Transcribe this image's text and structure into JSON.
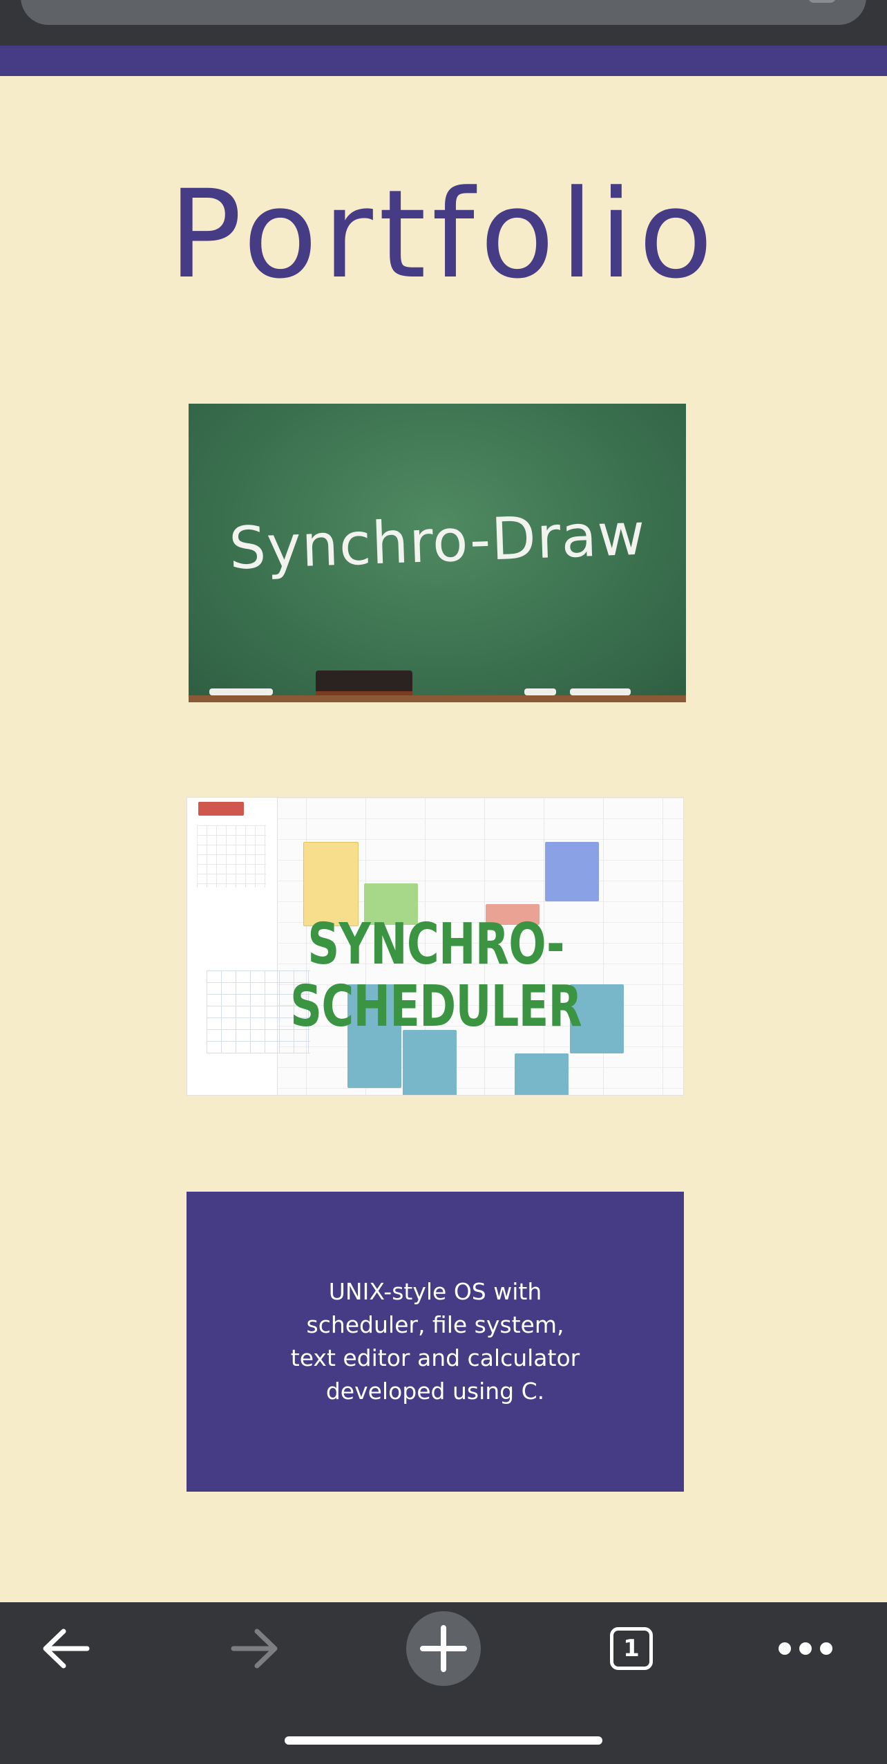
{
  "page": {
    "title": "Portfolio",
    "accent_color": "#463c86",
    "background_color": "#f7ecca"
  },
  "projects": [
    {
      "id": "synchro-draw",
      "image_text": "Synchro-Draw"
    },
    {
      "id": "synchro-scheduler",
      "image_text": "SYNCHRO-SCHEDULER"
    },
    {
      "id": "unix-os",
      "description_lines": [
        "UNIX-style OS with",
        "scheduler, file system,",
        "text editor and calculator",
        "developed using C."
      ]
    }
  ],
  "browser": {
    "toolbar": {
      "back_icon": "arrow-left-icon",
      "forward_icon": "arrow-right-icon",
      "new_tab_icon": "plus-icon",
      "tab_count": "1",
      "menu_icon": "more-horizontal-icon"
    }
  }
}
